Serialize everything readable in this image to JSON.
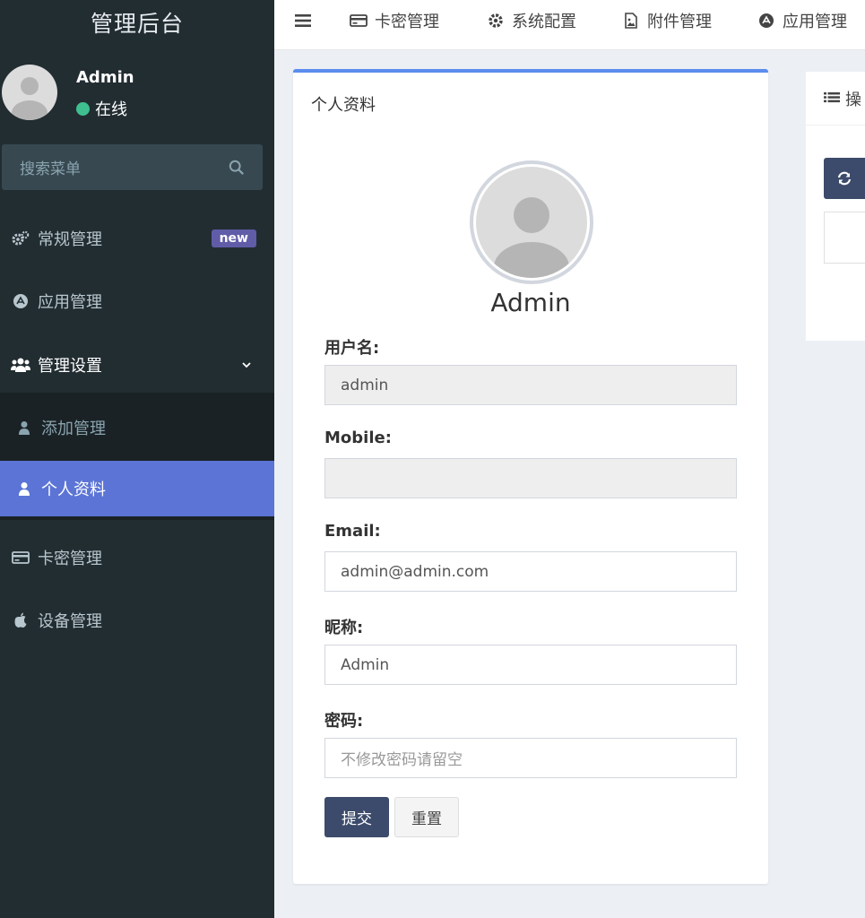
{
  "app": {
    "title": "管理后台"
  },
  "user": {
    "name": "Admin",
    "status": "在线"
  },
  "search": {
    "placeholder": "搜索菜单"
  },
  "sidebar": {
    "items": [
      {
        "label": "常规管理",
        "badge": "new",
        "icon": "cogs-icon"
      },
      {
        "label": "应用管理",
        "icon": "app-store-icon"
      },
      {
        "label": "管理设置",
        "icon": "users-icon"
      },
      {
        "label": "卡密管理",
        "icon": "credit-card-icon"
      },
      {
        "label": "设备管理",
        "icon": "apple-icon"
      }
    ],
    "submenu": [
      {
        "label": "添加管理",
        "icon": "user-icon"
      },
      {
        "label": "个人资料",
        "icon": "user-icon",
        "active": true
      }
    ]
  },
  "topnav": {
    "items": [
      {
        "label": "卡密管理",
        "icon": "credit-card-icon"
      },
      {
        "label": "系统配置",
        "icon": "gear-icon"
      },
      {
        "label": "附件管理",
        "icon": "image-file-icon"
      },
      {
        "label": "应用管理",
        "icon": "app-store-icon"
      }
    ]
  },
  "profile": {
    "box_title": "个人资料",
    "display_name": "Admin",
    "fields": {
      "username": {
        "label": "用户名:",
        "value": "admin"
      },
      "mobile": {
        "label": "Mobile:",
        "value": ""
      },
      "email": {
        "label": "Email:",
        "value": "admin@admin.com"
      },
      "nickname": {
        "label": "昵称:",
        "value": "Admin"
      },
      "password": {
        "label": "密码:",
        "placeholder": "不修改密码请留空"
      }
    },
    "submit_label": "提交",
    "reset_label": "重置"
  },
  "side_panel": {
    "title": "操"
  },
  "colors": {
    "sidebar_bg": "#222d32",
    "active_item": "#5b74d5",
    "primary_button": "#3c4b6b",
    "box_accent": "#5a8dee",
    "status_online": "#3fbf8f",
    "badge": "#605ca8"
  }
}
